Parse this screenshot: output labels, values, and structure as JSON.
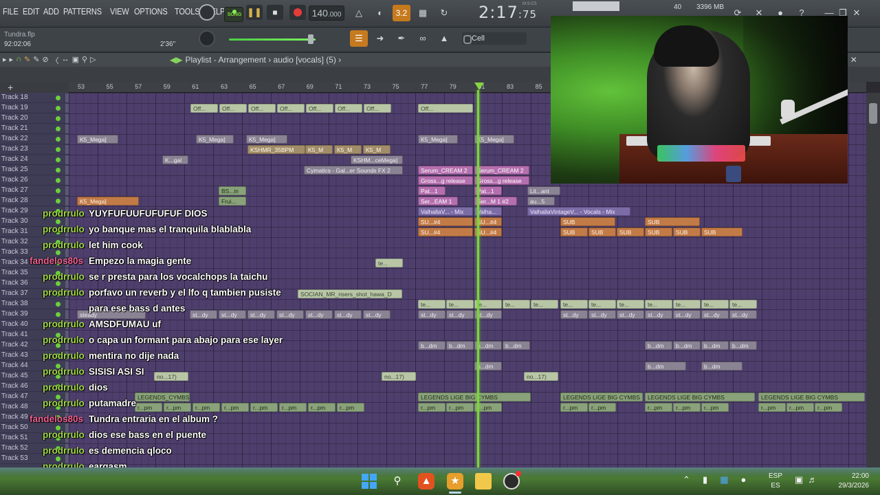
{
  "menu": [
    "FILE",
    "EDIT",
    "ADD",
    "PATTERNS",
    "VIEW",
    "OPTIONS",
    "TOOLS",
    "HELP"
  ],
  "transport": {
    "song_label": "SONG",
    "tempo": "140",
    "tempo_decimals": ".000",
    "time_main": "2:17",
    "time_sub": ":75",
    "time_mode": "M:S:CS",
    "cpu": "40",
    "memory": "3396 MB",
    "pattern_label": "3.2"
  },
  "project": {
    "file_name": "Tundra.flp",
    "elapsed": "92:02:06",
    "length": "2'36\""
  },
  "snap": {
    "label": "Cell"
  },
  "playlist": {
    "title_prefix": "Playlist - Arrangement",
    "title_suffix": "audio [vocals] (5)",
    "ruler": [
      "53",
      "55",
      "57",
      "59",
      "61",
      "63",
      "65",
      "67",
      "69",
      "71",
      "73",
      "75",
      "77",
      "79",
      "81",
      "83",
      "85"
    ],
    "tracks": [
      "Track 18",
      "Track 19",
      "Track 20",
      "Track 21",
      "Track 22",
      "Track 23",
      "Track 24",
      "Track 25",
      "Track 26",
      "Track 27",
      "Track 28",
      "Track 29",
      "Track 30",
      "Track 31",
      "Track 32",
      "Track 33",
      "Track 34",
      "Track 35",
      "Track 36",
      "Track 37",
      "Track 38",
      "Track 39",
      "Track 40",
      "Track 41",
      "Track 42",
      "Track 43",
      "Track 44",
      "Track 45",
      "Track 46",
      "Track 47",
      "Track 48",
      "Track 49",
      "Track 50",
      "Track 51",
      "Track 52",
      "Track 53"
    ],
    "clips": {
      "offs": "Off...",
      "ks_mega": "K5_Mega]",
      "kshmr": "KSHMR_35BPM",
      "ks_m": "K5_M",
      "ksm_cemega": "KSHM...ceMega]",
      "cymatics": "Cymatics - Gal...er Sounds FX 2",
      "serum_cream": "Serum_CREAM 2",
      "gross_release": "Gross...g release",
      "pat": "Pat...1",
      "lit_ant": "Lit...ant",
      "ser_eam": "Ser...EAM 1",
      "ser_m": "Ser...M 1 #2",
      "au_5": "au...5",
      "valhalla": "ValhallaV... - Mix",
      "valha": "Valha...",
      "valhalla_vocals": "ValhallaVintageV... - Vocals - Mix",
      "su": "SU...#4",
      "sub": "SUB",
      "bs_in": "BS...in",
      "frui": "Frui...",
      "ksm_gal": "K...gal",
      "socian": "SOCIAN_MR_risers_shot_hawa_D",
      "te": "te...",
      "st_dy": "st...dy",
      "steady": "steady",
      "b_dm": "b...dm",
      "no17": "no...17)",
      "legends": "LEGENDS LIGE BIG CYMBS",
      "legends_short": "LEGENDS_CYMBS",
      "r_pm": "r...pm"
    }
  },
  "chat": [
    {
      "user": "prodrrulo",
      "text": "YUYFUFUUFUFUFUF DIOS",
      "color": "#a2d94a"
    },
    {
      "user": "prodrrulo",
      "text": "yo banque mas el tranquila blablabla",
      "color": "#a2d94a"
    },
    {
      "user": "prodrrulo",
      "text": "let him cook",
      "color": "#a2d94a"
    },
    {
      "user": "fandelos80s",
      "text": "Empezo la magia gente",
      "color": "#f06292"
    },
    {
      "user": "prodrrulo",
      "text": "se r presta para los vocalchops la taichu",
      "color": "#a2d94a"
    },
    {
      "user": "prodrrulo",
      "text": "porfavo un reverb y el lfo q tambien pusiste",
      "color": "#a2d94a"
    },
    {
      "user": "",
      "text": "para ese bass d antes",
      "color": "#a2d94a"
    },
    {
      "user": "prodrrulo",
      "text": "AMSDFUMAU uf",
      "color": "#a2d94a"
    },
    {
      "user": "prodrrulo",
      "text": "o capa un formant para abajo para ese layer",
      "color": "#a2d94a"
    },
    {
      "user": "prodrrulo",
      "text": "mentira no dije nada",
      "color": "#a2d94a"
    },
    {
      "user": "prodrrulo",
      "text": "SISISI ASI SI",
      "color": "#a2d94a"
    },
    {
      "user": "prodrrulo",
      "text": "dios",
      "color": "#a2d94a"
    },
    {
      "user": "prodrrulo",
      "text": "putamadre",
      "color": "#a2d94a"
    },
    {
      "user": "fandelos80s",
      "text": "Tundra entraria en el album ?",
      "color": "#f06292"
    },
    {
      "user": "prodrrulo",
      "text": "dios ese bass en el puente",
      "color": "#a2d94a"
    },
    {
      "user": "prodrrulo",
      "text": "es demencia qloco",
      "color": "#a2d94a"
    },
    {
      "user": "prodrrulo",
      "text": "eargasm",
      "color": "#a2d94a"
    }
  ],
  "taskbar": {
    "lang_top": "ESP",
    "lang_bottom": "ES",
    "time": "22:00",
    "date": "29/3/2026"
  }
}
